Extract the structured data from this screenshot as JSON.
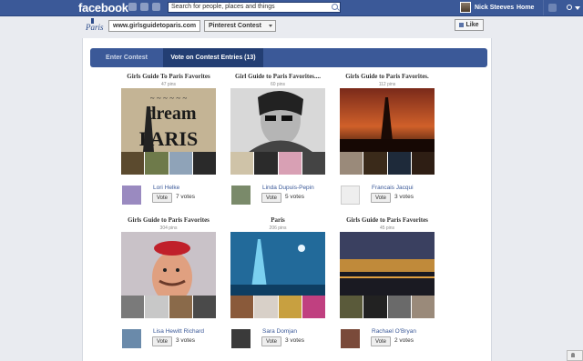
{
  "topbar": {
    "logo": "facebook",
    "search_placeholder": "Search for people, places and things",
    "user_name": "Nick Steeves",
    "home_label": "Home"
  },
  "page": {
    "logo_text": "Paris",
    "site_badge": "www.girlsguidetoparis.com",
    "contest_select": "Pinterest Contest",
    "like_label": "Like"
  },
  "tabs": [
    {
      "label": "Enter Contest"
    },
    {
      "label": "Vote on Contest Entries (13)"
    }
  ],
  "vote_label": "Vote",
  "entries": [
    {
      "title": "Girls Guide To Paris Favorites",
      "pins": "47 pins",
      "voter": "Lori Helke",
      "votes": "7 votes"
    },
    {
      "title": "Girl Guide to Paris Favorites....",
      "pins": "60 pins",
      "voter": "Linda Dupuis-Pepin",
      "votes": "5 votes"
    },
    {
      "title": "Girls Guide to Paris Favorites.",
      "pins": "112 pins",
      "voter": "Francais Jacqui",
      "votes": "3 votes"
    },
    {
      "title": "Girls Guide to Paris Favorites",
      "pins": "304 pins",
      "voter": "Lisa Hewitt Richard",
      "votes": "3 votes"
    },
    {
      "title": "Paris",
      "pins": "206 pins",
      "voter": "Sara Domjan",
      "votes": "3 votes"
    },
    {
      "title": "Girls Guide to Paris Favorites",
      "pins": "45 pins",
      "voter": "Rachael O'Bryan",
      "votes": "2 votes"
    }
  ],
  "colors": {
    "brand": "#3b5998",
    "tab_active": "#233e73",
    "link": "#3b5998"
  }
}
